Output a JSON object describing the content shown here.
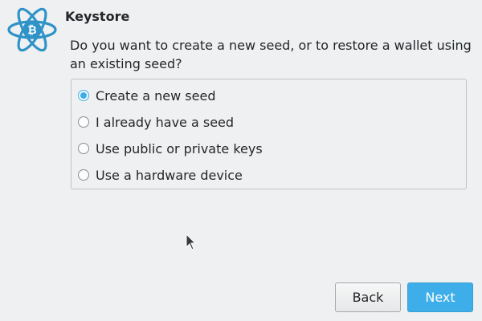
{
  "header": {
    "title": "Keystore"
  },
  "prompt": {
    "question": "Do you want to create a new seed, or to restore a wallet using an existing seed?"
  },
  "options": [
    {
      "label": "Create a new seed",
      "selected": true
    },
    {
      "label": "I already have a seed",
      "selected": false
    },
    {
      "label": "Use public or private keys",
      "selected": false
    },
    {
      "label": "Use a hardware device",
      "selected": false
    }
  ],
  "buttons": {
    "back_label": "Back",
    "next_label": "Next"
  },
  "colors": {
    "accent": "#3daee9",
    "background": "#eff0f1",
    "text": "#232629"
  },
  "icons": {
    "logo": "electrum-bitcoin-atom-logo-icon",
    "cursor": "mouse-pointer-icon"
  }
}
